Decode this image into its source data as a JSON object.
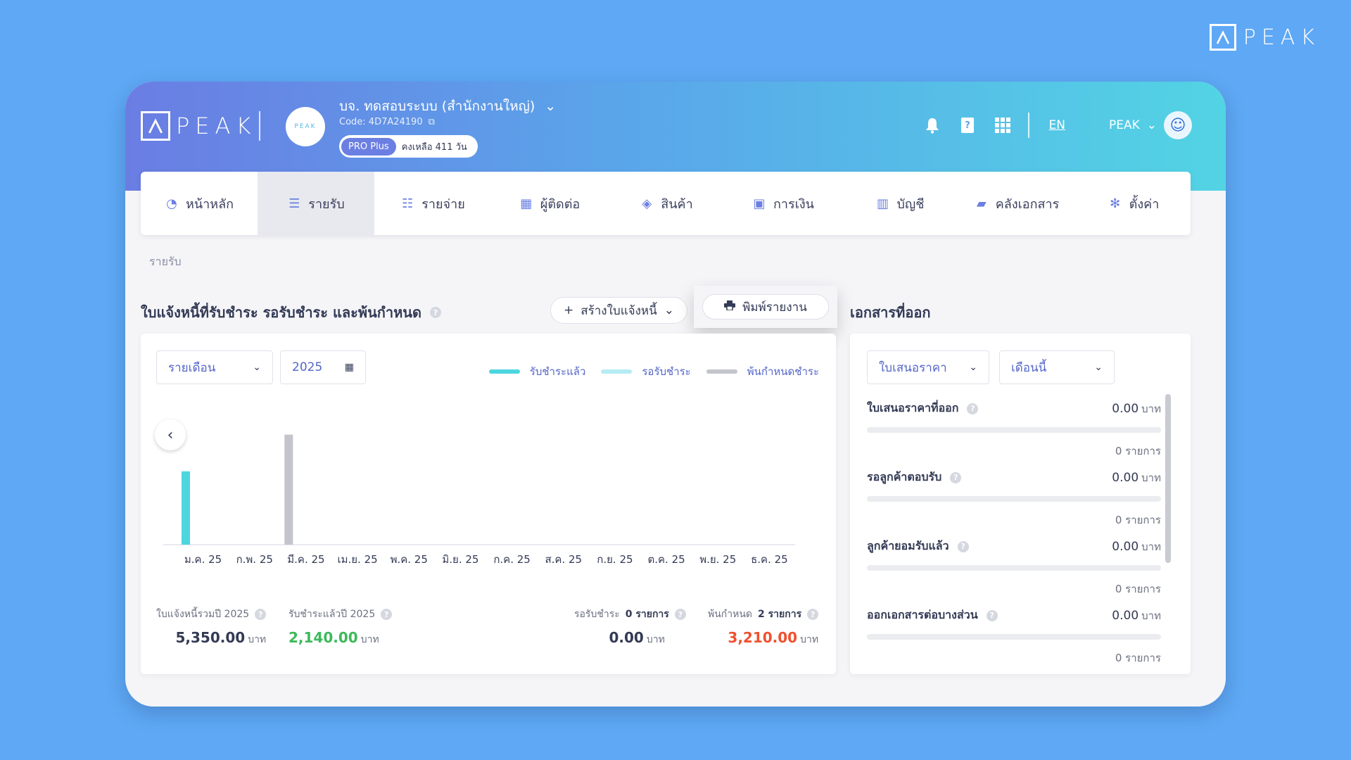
{
  "brand": {
    "corner_logo_text": "PEAK",
    "app_logo_text": "PEAK",
    "avatar_logo_text": "PEAK"
  },
  "header": {
    "company_name": "บจ. ทดสอบระบบ (สำนักงานใหญ่)",
    "company_code": "Code: 4D7A24190",
    "plan_name": "PRO Plus",
    "plan_days": "คงเหลือ 411 วัน",
    "language_link": "EN",
    "user_name": "PEAK",
    "icons": [
      "bell-icon",
      "help-book-icon",
      "apps-grid-icon"
    ]
  },
  "nav": [
    {
      "label": "หน้าหลัก",
      "icon": "dashboard-icon",
      "active": false
    },
    {
      "label": "รายรับ",
      "icon": "income-icon",
      "active": true
    },
    {
      "label": "รายจ่าย",
      "icon": "expense-icon",
      "active": false
    },
    {
      "label": "ผู้ติดต่อ",
      "icon": "contacts-icon",
      "active": false
    },
    {
      "label": "สินค้า",
      "icon": "product-box-icon",
      "active": false
    },
    {
      "label": "การเงิน",
      "icon": "money-icon",
      "active": false
    },
    {
      "label": "บัญชี",
      "icon": "ledger-icon",
      "active": false
    },
    {
      "label": "คลังเอกสาร",
      "icon": "folder-icon",
      "active": false
    },
    {
      "label": "ตั้งค่า",
      "icon": "gear-icon",
      "active": false
    }
  ],
  "breadcrumb": "รายรับ",
  "invoice_section": {
    "title": "ใบแจ้งหนี้ที่รับชำระ รอรับชำระ และพ้นกำหนด",
    "create_button": "สร้างใบแจ้งหนี้",
    "print_button": "พิมพ์รายงาน",
    "period_select": "รายเดือน",
    "year_input": "2025"
  },
  "chart_data": {
    "type": "bar",
    "categories": [
      "ม.ค. 25",
      "ก.พ. 25",
      "มี.ค. 25",
      "เม.ย. 25",
      "พ.ค. 25",
      "มิ.ย. 25",
      "ก.ค. 25",
      "ส.ค. 25",
      "ก.ย. 25",
      "ต.ค. 25",
      "พ.ย. 25",
      "ธ.ค. 25"
    ],
    "series": [
      {
        "name": "รับชำระแล้ว",
        "color": "#4dd6e0",
        "values": [
          2140,
          0,
          0,
          0,
          0,
          0,
          0,
          0,
          0,
          0,
          0,
          0
        ]
      },
      {
        "name": "รอรับชำระ",
        "color": "#b6ecf3",
        "values": [
          0,
          0,
          0,
          0,
          0,
          0,
          0,
          0,
          0,
          0,
          0,
          0
        ]
      },
      {
        "name": "พ้นกำหนดชำระ",
        "color": "#c3c4cc",
        "values": [
          0,
          0,
          3210,
          0,
          0,
          0,
          0,
          0,
          0,
          0,
          0,
          0
        ]
      }
    ],
    "ylim": [
      0,
      3900
    ],
    "grid": false,
    "legend": "top-right"
  },
  "stats": {
    "total_label": "ใบแจ้งหนี้รวมปี 2025",
    "total_value": "5,350.00",
    "paid_label": "รับชำระแล้วปี 2025",
    "paid_value": "2,140.00",
    "pending_label": "รอรับชำระ",
    "pending_count": "0 รายการ",
    "pending_value": "0.00",
    "overdue_label": "พ้นกำหนด",
    "overdue_count": "2 รายการ",
    "overdue_value": "3,210.00",
    "unit": "บาท",
    "paid_color": "#3cb95a",
    "overdue_color": "#f0502f"
  },
  "documents_section": {
    "title": "เอกสารที่ออก",
    "type_select": "ใบเสนอราคา",
    "period_select": "เดือนนี้",
    "rows": [
      {
        "title": "ใบเสนอราคาที่ออก",
        "amount": "0.00",
        "unit": "บาท",
        "count": "0 รายการ"
      },
      {
        "title": "รอลูกค้าตอบรับ",
        "amount": "0.00",
        "unit": "บาท",
        "count": "0 รายการ"
      },
      {
        "title": "ลูกค้ายอมรับแล้ว",
        "amount": "0.00",
        "unit": "บาท",
        "count": "0 รายการ"
      },
      {
        "title": "ออกเอกสารต่อบางส่วน",
        "amount": "0.00",
        "unit": "บาท",
        "count": "0 รายการ"
      }
    ]
  },
  "colors": {
    "background": "#5ea8f5",
    "accent": "#6b7fe3",
    "header_start": "#6a7de3",
    "header_end": "#52d4e4"
  }
}
